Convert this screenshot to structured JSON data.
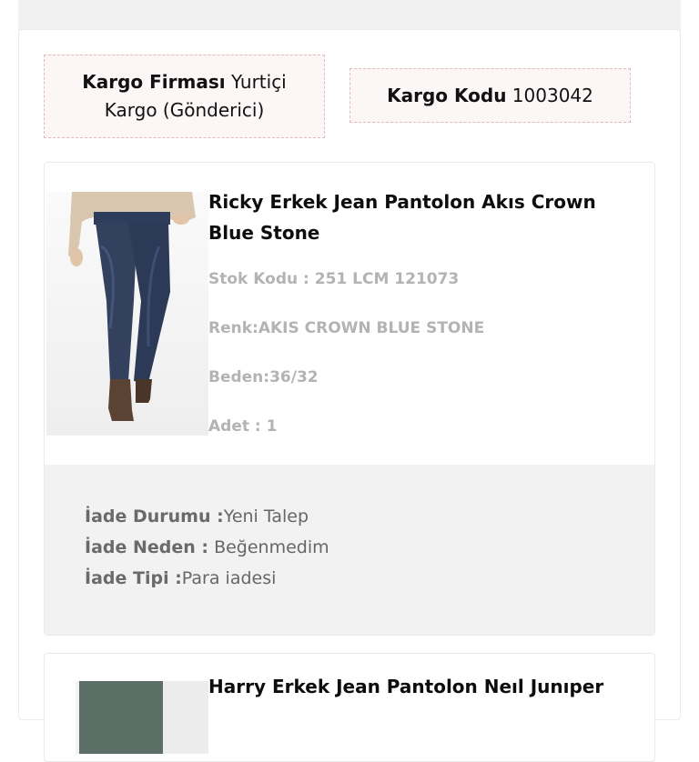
{
  "cargo": {
    "firm_label": "Kargo Firması",
    "firm_value": "Yurtiçi Kargo (Gönderici)",
    "code_label": "Kargo Kodu",
    "code_value": "1003042"
  },
  "items": [
    {
      "title": "Ricky Erkek Jean Pantolon Akıs Crown Blue Stone",
      "stock_code": "Stok Kodu : 251 LCM 121073",
      "color": "Renk:AKIS CROWN BLUE STONE",
      "size": "Beden:36/32",
      "quantity": "Adet : 1",
      "image": "jeans-product-photo",
      "return": {
        "status_label": "İade Durumu :",
        "status_value": "Yeni Talep",
        "reason_label": "İade Neden :",
        "reason_value": "Beğenmedim",
        "type_label": "İade Tipi :",
        "type_value": "Para iadesi"
      }
    },
    {
      "title": "Harry Erkek Jean Pantolon Neıl Junıper",
      "image": "jeans-product-photo"
    }
  ],
  "colors": {
    "dashed_border": "#e3b9b9",
    "cargo_bg": "#fdf6f6",
    "status_bg": "#f2f2f2",
    "meta_text": "#b3b3b3"
  }
}
